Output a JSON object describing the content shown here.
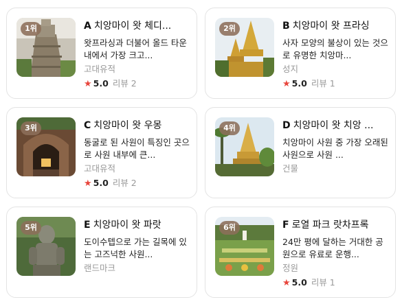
{
  "accent_color": "#e8453c",
  "badge_color": "#8c6e5a",
  "cards": [
    {
      "rank": "1위",
      "letter": "A",
      "name": "치앙마이 왓 체디...",
      "desc": "왓프라싱과 더불어 올드 타운 내에서 가장 크고...",
      "category": "고대유적",
      "star": "★",
      "score": "5.0",
      "reviews": "리뷰 2",
      "thumb_icon": "ruined-chedi-photo"
    },
    {
      "rank": "2위",
      "letter": "B",
      "name": "치앙마이 왓 프라싱",
      "desc": "사자 모양의 불상이 있는 것으로 유명한 치앙마...",
      "category": "성지",
      "star": "★",
      "score": "5.0",
      "reviews": "리뷰 1",
      "thumb_icon": "golden-stupa-photo"
    },
    {
      "rank": "3위",
      "letter": "C",
      "name": "치앙마이 왓 우몽",
      "desc": "동굴로 된 사원이 특징인 곳으로 사원 내부에 큰...",
      "category": "고대유적",
      "star": "★",
      "score": "5.0",
      "reviews": "리뷰 2",
      "thumb_icon": "tunnel-temple-photo"
    },
    {
      "rank": "4위",
      "letter": "D",
      "name": "치앙마이 왓 치앙 ...",
      "desc": "치앙마이 사원 중 가장 오래된 사원으로 사원 ...",
      "category": "건물",
      "star": "",
      "score": "",
      "reviews": "",
      "thumb_icon": "golden-chedi-palms-photo"
    },
    {
      "rank": "5위",
      "letter": "E",
      "name": "치앙마이 왓 파랏",
      "desc": "도이수텝으로 가는 길목에 있는 고즈넉한 사원...",
      "category": "랜드마크",
      "star": "",
      "score": "",
      "reviews": "",
      "thumb_icon": "stone-statue-photo"
    },
    {
      "rank": "6위",
      "letter": "F",
      "name": "로열 파크 랏차프록",
      "desc": "24만 평에 달하는 거대한 공원으로 유료로 운행...",
      "category": "정원",
      "star": "★",
      "score": "5.0",
      "reviews": "리뷰 1",
      "thumb_icon": "royal-park-garden-photo"
    }
  ]
}
